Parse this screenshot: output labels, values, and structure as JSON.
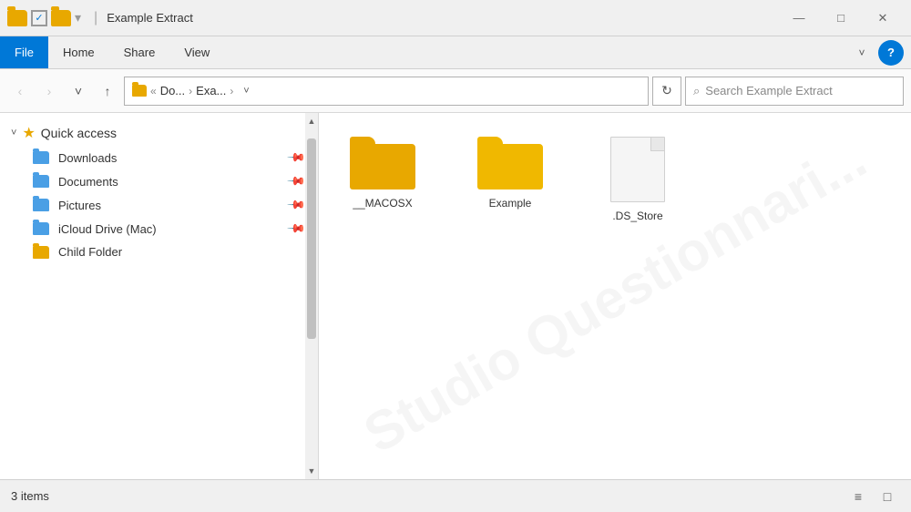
{
  "window": {
    "title": "Example Extract",
    "controls": {
      "minimize": "—",
      "maximize": "□",
      "close": "✕"
    }
  },
  "menu": {
    "items": [
      "File",
      "Home",
      "Share",
      "View"
    ],
    "active_index": 0
  },
  "toolbar": {
    "nav": {
      "back": "‹",
      "forward": "›",
      "down": "˅",
      "up": "↑"
    },
    "address": {
      "prefix": "«",
      "path1": "Do...",
      "arrow": "›",
      "path2": "Exa...",
      "chevron": "›"
    },
    "search_placeholder": "Search Example Extract"
  },
  "sidebar": {
    "quick_access": {
      "label": "Quick access",
      "chevron": "˅",
      "star": "★"
    },
    "items": [
      {
        "label": "Downloads",
        "folder_type": "blue",
        "pinned": true
      },
      {
        "label": "Documents",
        "folder_type": "blue",
        "pinned": true
      },
      {
        "label": "Pictures",
        "folder_type": "blue",
        "pinned": true
      },
      {
        "label": "iCloud Drive (Mac)",
        "folder_type": "blue",
        "pinned": true
      },
      {
        "label": "Child Folder",
        "folder_type": "yellow",
        "pinned": false
      }
    ]
  },
  "content": {
    "files": [
      {
        "name": "__MACOSX",
        "type": "folder",
        "variant": "gold"
      },
      {
        "name": "Example",
        "type": "folder",
        "variant": "amber"
      },
      {
        "name": ".DS_Store",
        "type": "file"
      }
    ]
  },
  "statusbar": {
    "count": "3 items",
    "view_icons": [
      "≡",
      "□"
    ]
  }
}
